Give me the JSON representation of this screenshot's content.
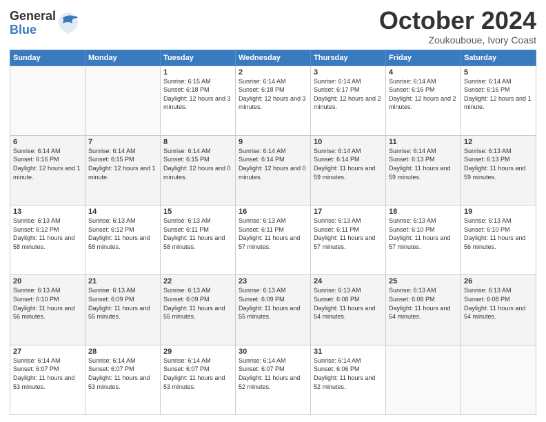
{
  "header": {
    "logo_general": "General",
    "logo_blue": "Blue",
    "month": "October 2024",
    "location": "Zoukouboue, Ivory Coast"
  },
  "days_of_week": [
    "Sunday",
    "Monday",
    "Tuesday",
    "Wednesday",
    "Thursday",
    "Friday",
    "Saturday"
  ],
  "weeks": [
    [
      {
        "day": "",
        "sunrise": "",
        "sunset": "",
        "daylight": ""
      },
      {
        "day": "",
        "sunrise": "",
        "sunset": "",
        "daylight": ""
      },
      {
        "day": "1",
        "sunrise": "Sunrise: 6:15 AM",
        "sunset": "Sunset: 6:18 PM",
        "daylight": "Daylight: 12 hours and 3 minutes."
      },
      {
        "day": "2",
        "sunrise": "Sunrise: 6:14 AM",
        "sunset": "Sunset: 6:18 PM",
        "daylight": "Daylight: 12 hours and 3 minutes."
      },
      {
        "day": "3",
        "sunrise": "Sunrise: 6:14 AM",
        "sunset": "Sunset: 6:17 PM",
        "daylight": "Daylight: 12 hours and 2 minutes."
      },
      {
        "day": "4",
        "sunrise": "Sunrise: 6:14 AM",
        "sunset": "Sunset: 6:16 PM",
        "daylight": "Daylight: 12 hours and 2 minutes."
      },
      {
        "day": "5",
        "sunrise": "Sunrise: 6:14 AM",
        "sunset": "Sunset: 6:16 PM",
        "daylight": "Daylight: 12 hours and 1 minute."
      }
    ],
    [
      {
        "day": "6",
        "sunrise": "Sunrise: 6:14 AM",
        "sunset": "Sunset: 6:16 PM",
        "daylight": "Daylight: 12 hours and 1 minute."
      },
      {
        "day": "7",
        "sunrise": "Sunrise: 6:14 AM",
        "sunset": "Sunset: 6:15 PM",
        "daylight": "Daylight: 12 hours and 1 minute."
      },
      {
        "day": "8",
        "sunrise": "Sunrise: 6:14 AM",
        "sunset": "Sunset: 6:15 PM",
        "daylight": "Daylight: 12 hours and 0 minutes."
      },
      {
        "day": "9",
        "sunrise": "Sunrise: 6:14 AM",
        "sunset": "Sunset: 6:14 PM",
        "daylight": "Daylight: 12 hours and 0 minutes."
      },
      {
        "day": "10",
        "sunrise": "Sunrise: 6:14 AM",
        "sunset": "Sunset: 6:14 PM",
        "daylight": "Daylight: 11 hours and 59 minutes."
      },
      {
        "day": "11",
        "sunrise": "Sunrise: 6:14 AM",
        "sunset": "Sunset: 6:13 PM",
        "daylight": "Daylight: 11 hours and 59 minutes."
      },
      {
        "day": "12",
        "sunrise": "Sunrise: 6:13 AM",
        "sunset": "Sunset: 6:13 PM",
        "daylight": "Daylight: 11 hours and 59 minutes."
      }
    ],
    [
      {
        "day": "13",
        "sunrise": "Sunrise: 6:13 AM",
        "sunset": "Sunset: 6:12 PM",
        "daylight": "Daylight: 11 hours and 58 minutes."
      },
      {
        "day": "14",
        "sunrise": "Sunrise: 6:13 AM",
        "sunset": "Sunset: 6:12 PM",
        "daylight": "Daylight: 11 hours and 58 minutes."
      },
      {
        "day": "15",
        "sunrise": "Sunrise: 6:13 AM",
        "sunset": "Sunset: 6:11 PM",
        "daylight": "Daylight: 11 hours and 58 minutes."
      },
      {
        "day": "16",
        "sunrise": "Sunrise: 6:13 AM",
        "sunset": "Sunset: 6:11 PM",
        "daylight": "Daylight: 11 hours and 57 minutes."
      },
      {
        "day": "17",
        "sunrise": "Sunrise: 6:13 AM",
        "sunset": "Sunset: 6:11 PM",
        "daylight": "Daylight: 11 hours and 57 minutes."
      },
      {
        "day": "18",
        "sunrise": "Sunrise: 6:13 AM",
        "sunset": "Sunset: 6:10 PM",
        "daylight": "Daylight: 11 hours and 57 minutes."
      },
      {
        "day": "19",
        "sunrise": "Sunrise: 6:13 AM",
        "sunset": "Sunset: 6:10 PM",
        "daylight": "Daylight: 11 hours and 56 minutes."
      }
    ],
    [
      {
        "day": "20",
        "sunrise": "Sunrise: 6:13 AM",
        "sunset": "Sunset: 6:10 PM",
        "daylight": "Daylight: 11 hours and 56 minutes."
      },
      {
        "day": "21",
        "sunrise": "Sunrise: 6:13 AM",
        "sunset": "Sunset: 6:09 PM",
        "daylight": "Daylight: 11 hours and 55 minutes."
      },
      {
        "day": "22",
        "sunrise": "Sunrise: 6:13 AM",
        "sunset": "Sunset: 6:09 PM",
        "daylight": "Daylight: 11 hours and 55 minutes."
      },
      {
        "day": "23",
        "sunrise": "Sunrise: 6:13 AM",
        "sunset": "Sunset: 6:09 PM",
        "daylight": "Daylight: 11 hours and 55 minutes."
      },
      {
        "day": "24",
        "sunrise": "Sunrise: 6:13 AM",
        "sunset": "Sunset: 6:08 PM",
        "daylight": "Daylight: 11 hours and 54 minutes."
      },
      {
        "day": "25",
        "sunrise": "Sunrise: 6:13 AM",
        "sunset": "Sunset: 6:08 PM",
        "daylight": "Daylight: 11 hours and 54 minutes."
      },
      {
        "day": "26",
        "sunrise": "Sunrise: 6:13 AM",
        "sunset": "Sunset: 6:08 PM",
        "daylight": "Daylight: 11 hours and 54 minutes."
      }
    ],
    [
      {
        "day": "27",
        "sunrise": "Sunrise: 6:14 AM",
        "sunset": "Sunset: 6:07 PM",
        "daylight": "Daylight: 11 hours and 53 minutes."
      },
      {
        "day": "28",
        "sunrise": "Sunrise: 6:14 AM",
        "sunset": "Sunset: 6:07 PM",
        "daylight": "Daylight: 11 hours and 53 minutes."
      },
      {
        "day": "29",
        "sunrise": "Sunrise: 6:14 AM",
        "sunset": "Sunset: 6:07 PM",
        "daylight": "Daylight: 11 hours and 53 minutes."
      },
      {
        "day": "30",
        "sunrise": "Sunrise: 6:14 AM",
        "sunset": "Sunset: 6:07 PM",
        "daylight": "Daylight: 11 hours and 52 minutes."
      },
      {
        "day": "31",
        "sunrise": "Sunrise: 6:14 AM",
        "sunset": "Sunset: 6:06 PM",
        "daylight": "Daylight: 11 hours and 52 minutes."
      },
      {
        "day": "",
        "sunrise": "",
        "sunset": "",
        "daylight": ""
      },
      {
        "day": "",
        "sunrise": "",
        "sunset": "",
        "daylight": ""
      }
    ]
  ]
}
